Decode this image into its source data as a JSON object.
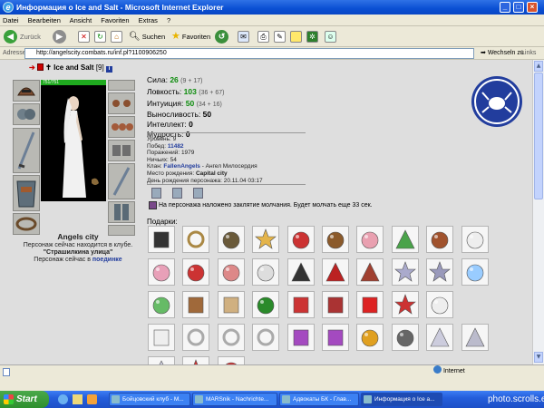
{
  "window": {
    "title": "Информация о Ice and Salt - Microsoft Internet Explorer"
  },
  "menu": [
    "Datei",
    "Bearbeiten",
    "Ansicht",
    "Favoriten",
    "Extras",
    "?"
  ],
  "toolbar": {
    "back": "Zurück",
    "search": "Suchen",
    "favorites": "Favoriten"
  },
  "address": {
    "label": "Adresse",
    "url": "http://angelscity.combats.ru/inf.pl?1100906250",
    "go": "Wechseln zu",
    "links": "Links"
  },
  "character": {
    "name": "Ice and Salt",
    "level": "[9]",
    "hp": "751/751",
    "city": "Angels city",
    "location_text": "Персонаж сейчас находится в клубе.",
    "location": "\"Страшилкина улица\"",
    "status_prefix": "Персонаж сейчас в",
    "status_link": "поединке"
  },
  "stats": [
    {
      "label": "Сила:",
      "value": "26",
      "extra": "(9 + 17)"
    },
    {
      "label": "Ловкость:",
      "value": "103",
      "extra": "(36 + 67)"
    },
    {
      "label": "Интуиция:",
      "value": "50",
      "extra": "(34 + 16)"
    },
    {
      "label": "Выносливость:",
      "value": "50",
      "extra": ""
    },
    {
      "label": "Интеллект:",
      "value": "0",
      "extra": ""
    },
    {
      "label": "Мудрость:",
      "value": "0",
      "extra": ""
    }
  ],
  "info": {
    "level": "Уровень: 9",
    "wins_label": "Побед:",
    "wins": "11482",
    "losses": "Поражений: 1979",
    "draws": "Ничьих: 54",
    "clan_label": "Клан:",
    "clan": "FallenAngels",
    "clan_rank": "- Ангел Милосердия",
    "birth_label": "Место рождения:",
    "birthplace": "Capital city",
    "birthday": "День рождения персонажа: 20.11.04 03:17"
  },
  "silence_notice": "На персонажа наложено заклятие молчания. Будет молчать еще 33 сек.",
  "gifts_label": "Подарки:",
  "statusbar": {
    "zone": "Internet"
  },
  "taskbar": {
    "start": "Start",
    "tasks": [
      "Бойцовский клуб - M...",
      "MARSnik - Nachrichte...",
      "Адвокаты БК - Глав...",
      "Информация о Ice a..."
    ]
  },
  "watermark": "photo.scrolls.eu",
  "colors": {
    "accent": "#223d9d",
    "stat_value": "#0b8b0b",
    "hp": "#1faa1f",
    "title_bar": "#0a4fd3"
  }
}
